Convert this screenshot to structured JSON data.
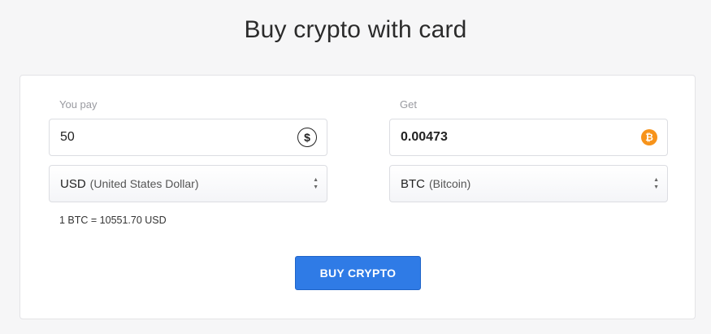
{
  "page": {
    "title": "Buy crypto with card"
  },
  "pay": {
    "label": "You pay",
    "amount": "50",
    "icon": "dollar-circle-icon",
    "currency_code": "USD",
    "currency_name": "(United States Dollar)"
  },
  "get": {
    "label": "Get",
    "amount": "0.00473",
    "icon": "bitcoin-icon",
    "currency_code": "BTC",
    "currency_name": "(Bitcoin)"
  },
  "rate_text": "1 BTC = 10551.70 USD",
  "buy_button_label": "BUY CRYPTO",
  "colors": {
    "accent": "#2f7be6",
    "bitcoin": "#f7931a",
    "background": "#f6f6f7"
  }
}
